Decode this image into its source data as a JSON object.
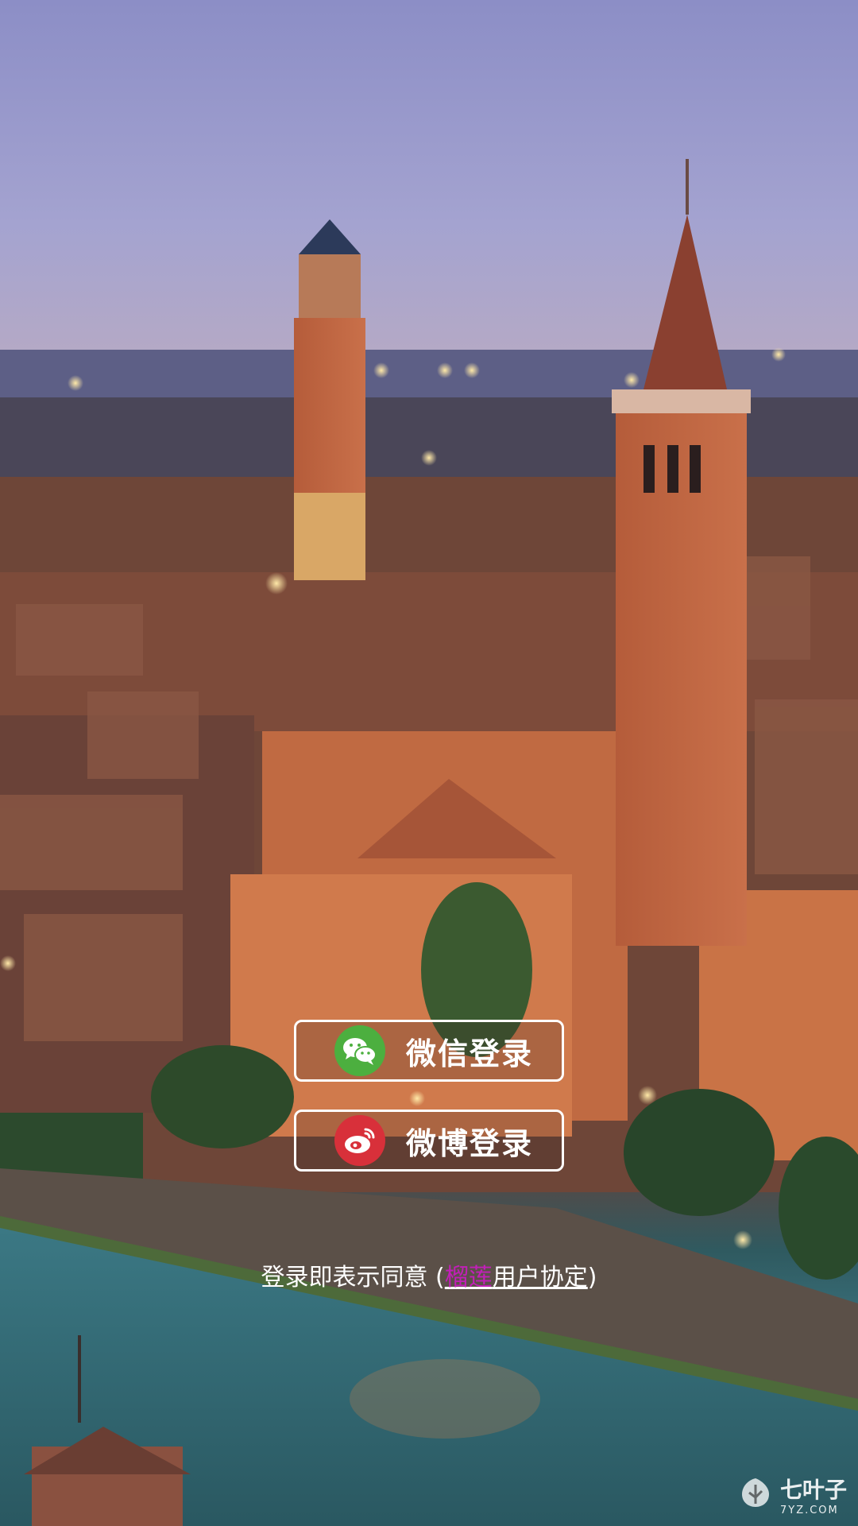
{
  "login": {
    "wechat_label": "微信登录",
    "weibo_label": "微博登录"
  },
  "agreement": {
    "prefix": "登录即表示同意 (",
    "brand": "榴莲",
    "suffix_link": "用户协定",
    "close": ")"
  },
  "watermark": {
    "name": "七叶子",
    "domain": "7YZ.COM"
  },
  "icons": {
    "wechat": "wechat-icon",
    "weibo": "weibo-icon",
    "watermark": "leaf-logo-icon"
  },
  "colors": {
    "wechat_green": "#4caf3f",
    "weibo_red": "#d8303a",
    "brand_magenta": "#c21fb8",
    "button_border": "#ffffff"
  }
}
